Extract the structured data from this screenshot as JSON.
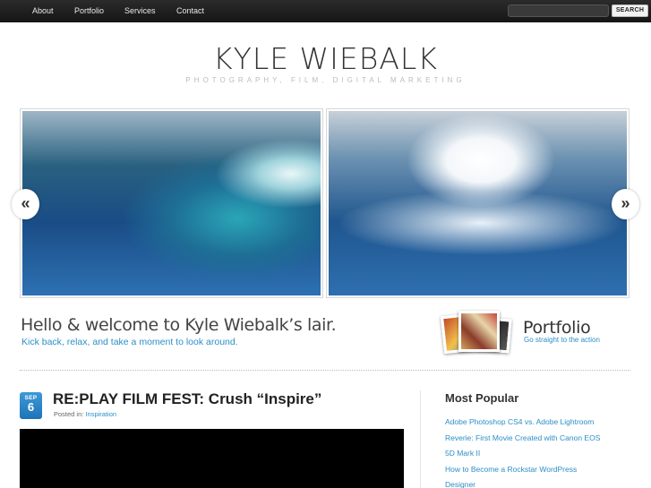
{
  "nav": {
    "items": [
      {
        "label": "About"
      },
      {
        "label": "Portfolio"
      },
      {
        "label": "Services"
      },
      {
        "label": "Contact"
      }
    ],
    "search_button": "SEARCH"
  },
  "logo": {
    "title": "KYLE WIEBALK",
    "tagline": "PHOTOGRAPHY, FILM, DIGITAL MARKETING"
  },
  "slider": {
    "prev_glyph": "«",
    "next_glyph": "»"
  },
  "welcome": {
    "heading": "Hello & welcome to Kyle Wiebalk’s lair.",
    "subtext": "Kick back, relax, and take a moment to look around."
  },
  "portfolio_promo": {
    "title": "Portfolio",
    "subtext": "Go straight to the action"
  },
  "post": {
    "date": {
      "month": "SEP",
      "day": "6"
    },
    "title": "RE:PLAY FILM FEST: Crush “Inspire”",
    "meta_prefix": "Posted in:",
    "category": "Inspiration"
  },
  "sidebar": {
    "heading": "Most Popular",
    "items": [
      {
        "label": "Adobe Photoshop CS4 vs. Adobe Lightroom"
      },
      {
        "label": "Reverie: First Movie Created with Canon EOS"
      },
      {
        "label": "5D Mark II"
      },
      {
        "label": "How to Become a Rockstar WordPress"
      },
      {
        "label": "Designer"
      }
    ]
  },
  "colors": {
    "accent_blue": "#2a8fc7",
    "topbar": "#1c1c1c"
  }
}
